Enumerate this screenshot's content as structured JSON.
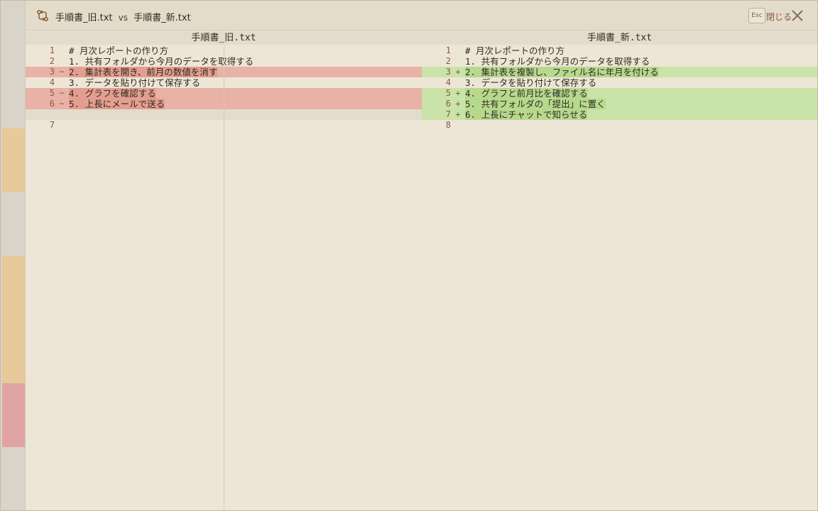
{
  "window": {
    "title_left": "手順書_旧.txt",
    "title_vs": "vs",
    "title_right": "手順書_新.txt",
    "esc_key": "Esc",
    "close_label": "閉じる"
  },
  "left_pane": {
    "header": "手順書_旧.txt",
    "lines": [
      {
        "num": "1",
        "mark": "",
        "text": "# 月次レポートの作り方",
        "type": "normal"
      },
      {
        "num": "2",
        "mark": "",
        "text": "1. 共有フォルダから今月のデータを取得する",
        "type": "normal"
      },
      {
        "num": "3",
        "mark": "−",
        "text": "2. 集計表を開き、前月の数値を消す",
        "type": "removed"
      },
      {
        "num": "4",
        "mark": "",
        "text": "3. データを貼り付けて保存する",
        "type": "normal"
      },
      {
        "num": "5",
        "mark": "−",
        "text": "4. グラフを確認する",
        "type": "removed"
      },
      {
        "num": "6",
        "mark": "−",
        "text": "5. 上長にメールで送る",
        "type": "removed"
      },
      {
        "num": "",
        "mark": "",
        "text": "",
        "type": "filler"
      },
      {
        "num": "7",
        "mark": "",
        "text": "",
        "type": "normal"
      }
    ]
  },
  "right_pane": {
    "header": "手順書_新.txt",
    "lines": [
      {
        "num": "1",
        "mark": "",
        "text": "# 月次レポートの作り方",
        "type": "normal"
      },
      {
        "num": "2",
        "mark": "",
        "text": "1. 共有フォルダから今月のデータを取得する",
        "type": "normal"
      },
      {
        "num": "3",
        "mark": "+",
        "text": "2. 集計表を複製し、ファイル名に年月を付ける",
        "type": "added"
      },
      {
        "num": "4",
        "mark": "",
        "text": "3. データを貼り付けて保存する",
        "type": "normal"
      },
      {
        "num": "5",
        "mark": "+",
        "text": "4. グラフと前月比を確認する",
        "type": "added"
      },
      {
        "num": "6",
        "mark": "+",
        "text": "5. 共有フォルダの「提出」に置く",
        "type": "added"
      },
      {
        "num": "7",
        "mark": "+",
        "text": "6. 上長にチャットで知らせる",
        "type": "added"
      },
      {
        "num": "8",
        "mark": "",
        "text": "",
        "type": "normal"
      }
    ]
  },
  "colors": {
    "removed_bg": "#e8b2a6",
    "added_bg": "#c9e3a8",
    "accent": "#8a5a3b"
  },
  "icons": {
    "diff": "git-compare-icon",
    "close": "close-icon"
  }
}
